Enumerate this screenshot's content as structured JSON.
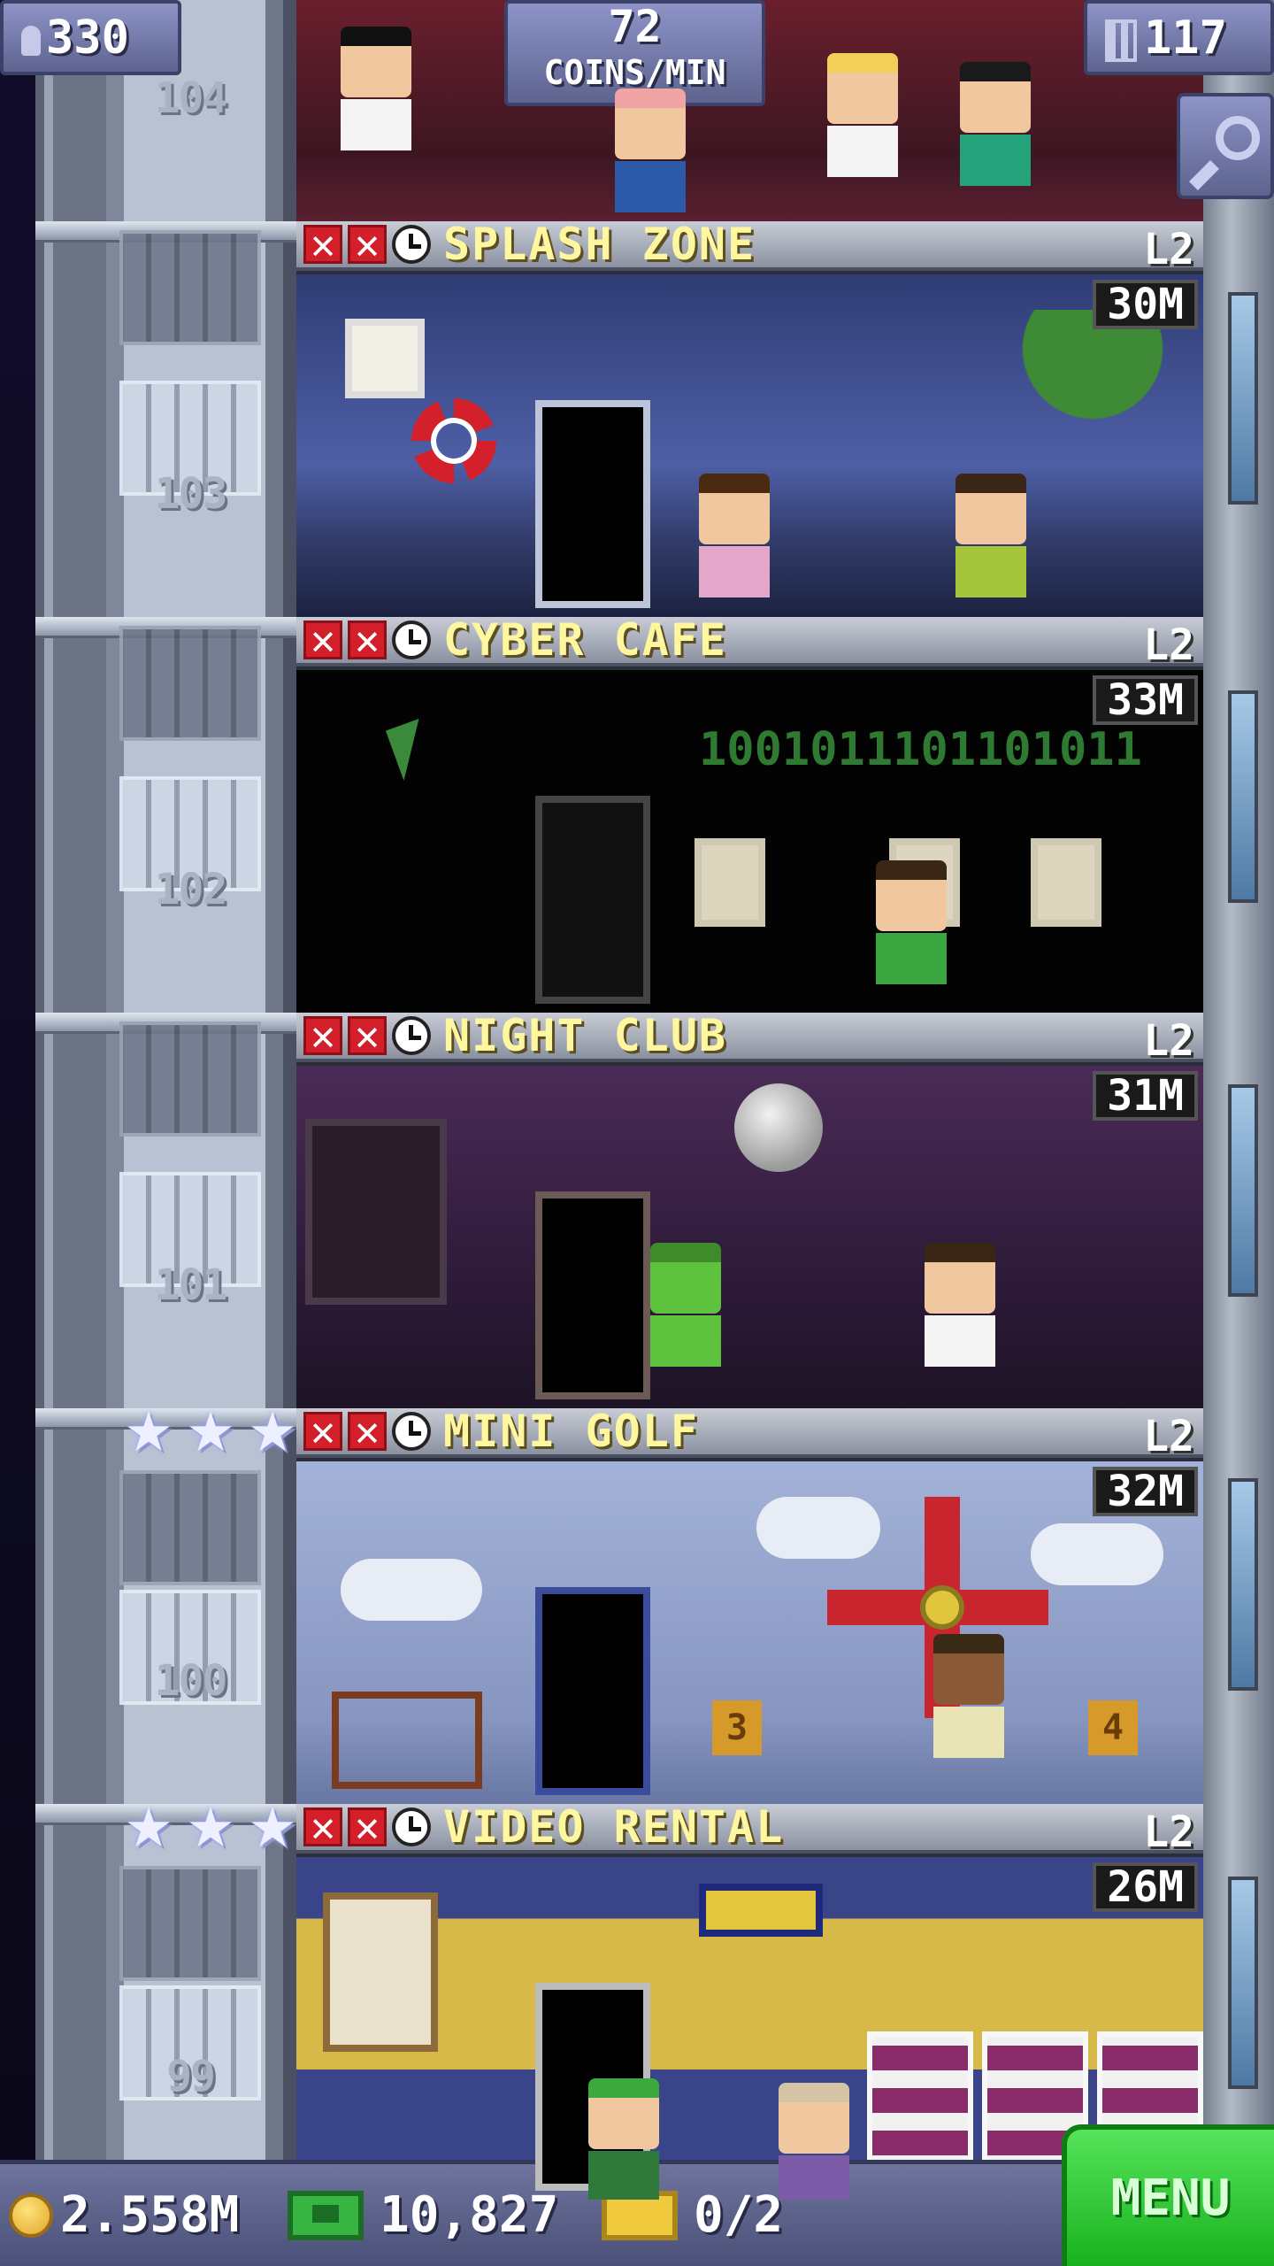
{
  "hud": {
    "population": "330",
    "coins_rate_value": "72",
    "coins_rate_unit": "COINS/MIN",
    "floor_count": "117"
  },
  "shaft": {
    "floors": [
      {
        "number": "104",
        "stars": 0
      },
      {
        "number": "103",
        "stars": 0
      },
      {
        "number": "102",
        "stars": 0
      },
      {
        "number": "101",
        "stars": 0
      },
      {
        "number": "100",
        "stars": 3
      },
      {
        "number": "99",
        "stars": 3
      }
    ]
  },
  "floors": [
    {
      "name": "SPLASH ZONE",
      "level": "L2",
      "income": "30M",
      "theme": "pool"
    },
    {
      "name": "CYBER CAFE",
      "level": "L2",
      "income": "33M",
      "theme": "computers",
      "screen_text": "1001011101101011"
    },
    {
      "name": "NIGHT CLUB",
      "level": "L2",
      "income": "31M",
      "theme": "disco"
    },
    {
      "name": "MINI GOLF",
      "level": "L2",
      "income": "32M",
      "theme": "windmill",
      "sign_left": "3",
      "sign_right": "4"
    },
    {
      "name": "VIDEO RENTAL",
      "level": "L2",
      "income": "26M",
      "theme": "shelves"
    }
  ],
  "bottom_bar": {
    "coins": "2.558M",
    "bux": "10,827",
    "tickets": "0/2",
    "menu_label": "MENU"
  },
  "colors": {
    "floor_name": "#fff6a0",
    "menu_green": "#19b21f",
    "hud_purple": "#5e648f"
  }
}
